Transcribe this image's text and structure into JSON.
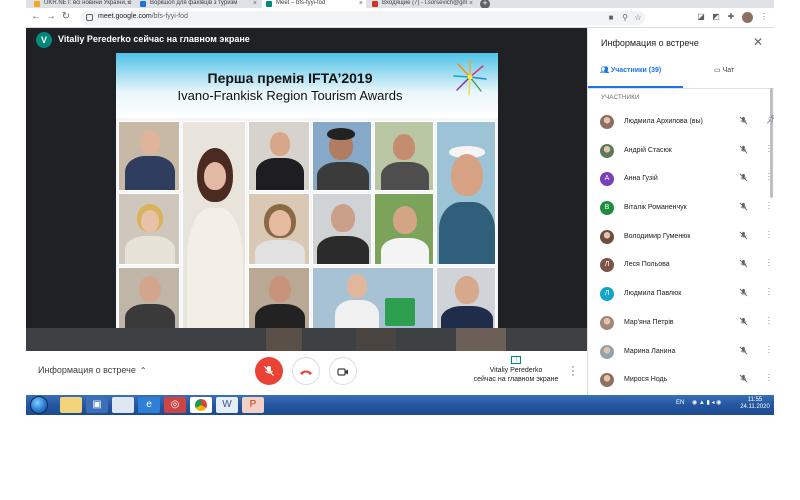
{
  "browser": {
    "tabs": [
      {
        "title": "UKR.NET: всі новини України, о",
        "color": "#f5a623"
      },
      {
        "title": "Воркшоп для фахівців з туризм",
        "color": "#1a73e8"
      },
      {
        "title": "Meet – bfs-fyyi-fod",
        "color": "#00897b"
      },
      {
        "title": "Входящие (7) - l.sorsevich@gm",
        "color": "#d93025"
      }
    ],
    "new_tab_label": "+",
    "url_host": "meet.google.com",
    "url_path": "/bfs-fyyi-fod"
  },
  "meet": {
    "presenter_initial": "V",
    "presenter_banner": "Vitaliy Perederko сейчас на главном экране",
    "slide": {
      "title_line1": "Перша премія IFTA’2019",
      "title_line2": "Ivano-Frankisk Region Tourism Awards"
    },
    "controls": {
      "meeting_info_label": "Информация о встрече",
      "presenting_line1": "Vitaliy Perederko",
      "presenting_line2": "сейчас на главном экране"
    },
    "panel": {
      "title": "Информация о встрече",
      "tab_people": "Участники (39)",
      "tab_chat": "Чат",
      "section_label": "УЧАСТНИКИ",
      "participants": [
        {
          "name": "Людмила Архипова (вы)",
          "initial": "",
          "color": "#8d6e63",
          "photo": true
        },
        {
          "name": "Андрій Стасюк",
          "initial": "",
          "color": "#5d7a5a",
          "photo": true
        },
        {
          "name": "Анна Гузій",
          "initial": "А",
          "color": "#7b3fb8",
          "photo": false
        },
        {
          "name": "Віталік Романенчук",
          "initial": "В",
          "color": "#1e8e3e",
          "photo": false
        },
        {
          "name": "Володимир Гуменюк",
          "initial": "",
          "color": "#6d4c41",
          "photo": true
        },
        {
          "name": "Леся Польова",
          "initial": "Л",
          "color": "#795548",
          "photo": false
        },
        {
          "name": "Людмила Павлюк",
          "initial": "Л",
          "color": "#12a4c9",
          "photo": false
        },
        {
          "name": "Мар'яна Петрів",
          "initial": "",
          "color": "#a1887f",
          "photo": true
        },
        {
          "name": "Марина Ланина",
          "initial": "",
          "color": "#90a4ae",
          "photo": true
        },
        {
          "name": "Мирося Нодь",
          "initial": "",
          "color": "#8d6e63",
          "photo": true
        }
      ]
    }
  },
  "taskbar": {
    "language": "EN",
    "time": "11:55",
    "date": "24.11.2020"
  }
}
